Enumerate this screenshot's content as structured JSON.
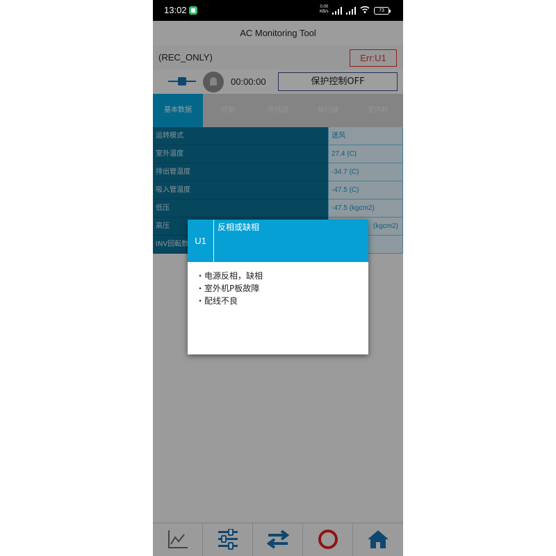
{
  "statusbar": {
    "time": "13:02",
    "net_speed_value": "0.00",
    "net_speed_unit": "KB/s",
    "battery": "73"
  },
  "app": {
    "title": "AC Monitoring Tool"
  },
  "mode": {
    "label": "(REC_ONLY)",
    "error_button": "Err:U1"
  },
  "controls": {
    "timer": "00:00:00",
    "protect_button": "保护控制OFF"
  },
  "tabs": [
    {
      "label": "基本数据",
      "active": true
    },
    {
      "label": "控制"
    },
    {
      "label": "传感器"
    },
    {
      "label": "执行器"
    },
    {
      "label": "室内机"
    }
  ],
  "table": [
    {
      "label": "运转模式",
      "value": "送风"
    },
    {
      "label": "室外温度",
      "value": "27.4 (C)"
    },
    {
      "label": "排出管温度",
      "value": "-34.7 (C)"
    },
    {
      "label": "吸入管温度",
      "value": "-47.5 (C)"
    },
    {
      "label": "低压",
      "value": "-47.5 (kgcm2)"
    },
    {
      "label": "高压",
      "value": "(kgcm2)"
    },
    {
      "label": "INV回転数",
      "value": ""
    }
  ],
  "dialog": {
    "code": "U1",
    "title": "反相或缺相",
    "items": [
      "・电源反相，缺相",
      "・室外机P板故障",
      "・配线不良"
    ]
  },
  "bottom_nav": [
    {
      "icon": "chart-icon"
    },
    {
      "icon": "sliders-icon"
    },
    {
      "icon": "swap-arrows-icon"
    },
    {
      "icon": "record-circle-icon"
    },
    {
      "icon": "home-icon"
    }
  ],
  "colors": {
    "accent": "#06a0d4",
    "table_label_bg": "#0b6f94",
    "error_red": "#e03030",
    "nav_blue": "#1a6fb0"
  }
}
